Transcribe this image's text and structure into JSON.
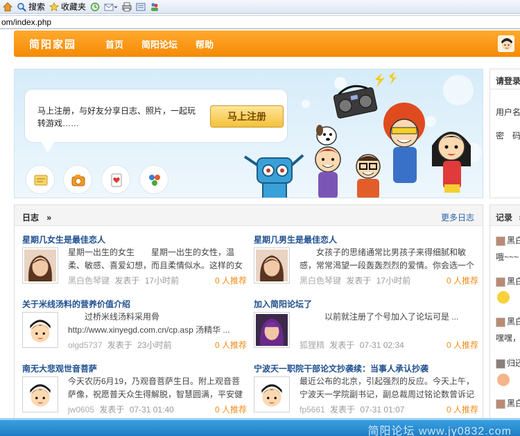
{
  "browser": {
    "toolbar": [
      {
        "icon": "home-icon",
        "label": ""
      },
      {
        "icon": "search-icon",
        "label": "搜索"
      },
      {
        "icon": "favorites-icon",
        "label": "收藏夹"
      },
      {
        "icon": "history-icon",
        "label": ""
      },
      {
        "icon": "mail-icon",
        "label": ""
      },
      {
        "icon": "print-icon",
        "label": ""
      },
      {
        "icon": "edit-icon",
        "label": ""
      },
      {
        "icon": "messenger-icon",
        "label": ""
      }
    ],
    "address": "om/index.php"
  },
  "nav": {
    "logo": "简阳家园",
    "links": [
      "首页",
      "简阳论坛",
      "帮助"
    ]
  },
  "banner": {
    "text": "马上注册，与好友分享日志、照片，一起玩转游戏……",
    "register_button": "马上注册"
  },
  "login": {
    "title": "请登录",
    "username_label": "用户名",
    "password_label": "密　码"
  },
  "blog": {
    "title": "日志",
    "arrow": "»",
    "more": "更多日志",
    "entries": [
      {
        "title": "星期几女生是最佳恋人",
        "body": "星期一出生的女生　　星期一出生的女性，温柔、敏感、喜爱幻想，而且柔情似水。这样的女 ...",
        "author": "黑白色琴键",
        "posted": "发表于",
        "time": "17小时前",
        "rec": "0 人推荐"
      },
      {
        "title": "星期几男生是最佳恋人",
        "body": "　　女孩子的思绪通常比男孩子来得细腻和敏感，常常渴望一段轰轰烈烈的爱情。你会选一个什 ...",
        "author": "黑白色琴键",
        "posted": "发表于",
        "time": "17小时前",
        "rec": "0 人推荐"
      },
      {
        "title": "关于米线汤料的营养价值介绍",
        "body": "　　过桥米线汤料采用骨 http://www.xinyegd.com.cn/cp.asp 汤精华 ...",
        "author": "olgd5737",
        "posted": "发表于",
        "time": "23小时前",
        "rec": "0 人推荐"
      },
      {
        "title": "加入简阳论坛了",
        "body": "　　　以前就注册了个号加入了论坛可是 ...",
        "author": "狐狸精",
        "posted": "发表于",
        "time": "07-31 02:34",
        "rec": "0 人推荐"
      },
      {
        "title": "南无大悲观世音菩萨",
        "body": "今天农历6月19，乃观音菩萨生日。附上观音菩萨像，祝愿普天众生得解脱，智慧圆满，平安健康 ...",
        "author": "jw0605",
        "posted": "发表于",
        "time": "07-31 01:40",
        "rec": "0 人推荐"
      },
      {
        "title": "宁波天一职院干部论文抄袭续：当事人承认抄袭",
        "body": "最近公布的北京，引起强烈的反应。今天上午，宁波天一学院副书记，副总裁周过铭论数曾诉记者 ...",
        "author": "fp5661",
        "posted": "发表于",
        "time": "07-31 01:07",
        "rec": "0 人推荐"
      }
    ]
  },
  "records": {
    "title": "记录",
    "arrow": "»",
    "items": [
      "黑白",
      "哦~~~",
      "黑白",
      "黑白",
      "嘿嘿，",
      "归还",
      "黑白"
    ]
  },
  "watermark": "简阳论坛 www.jy0832.com",
  "colors": {
    "nav": "#f58a06",
    "link": "#1f4f8f",
    "accent": "#f08c1a",
    "status_bar": "#1f7cc4"
  }
}
